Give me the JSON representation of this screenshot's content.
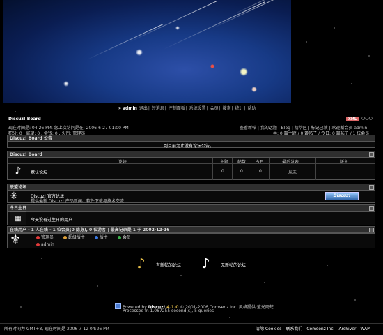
{
  "nav": {
    "user": "» admin",
    "links": [
      "退出",
      "短消息",
      "控制面板",
      "系统设置",
      "会员",
      "搜索",
      "统计",
      "帮助"
    ]
  },
  "board": {
    "name": "Discuz! Board",
    "xml_label": "XML",
    "time_line": "现在时间是: 04:26 PM, 您上次访问是在: 2006-6-27 01:00 PM",
    "points_line": "积分: 0 , 威望: 0 , 金钱: 0 , 头衔: 管理员",
    "right_links": "查看新帖 | 我的话题 | Blog | 精华区 | 标记已读 | 欢迎新会员 admin",
    "stats": "共: 0 篇主题 / 0 篇帖子 / 今日: 0 篇帖子 / 1 位会员"
  },
  "announcement": {
    "header": "Discuz! Board 公告",
    "text": "到目前为止没有论坛公告。"
  },
  "forum_table": {
    "header": "Discuz! Board",
    "columns": [
      "论坛",
      "主题",
      "帖数",
      "今日",
      "最后发表",
      "版主"
    ],
    "rows": [
      {
        "name": "默认论坛",
        "topics": "0",
        "posts": "0",
        "today": "0",
        "last": "从未",
        "mods": ""
      }
    ]
  },
  "links_section": {
    "header": "联盟论坛",
    "title": "Discuz! 官方论坛",
    "desc": "提供最新 Discuz! 产品新闻、软件下载与技术交流",
    "badge": "Discuz!"
  },
  "birthday": {
    "header": "今日生日",
    "text": "今天没有过生日的用户"
  },
  "online": {
    "header": "在线用户 - 1 人在线 - 1 位会员(0 隐身), 0 位游客 | 最高记录是 1 于 2002-12-16",
    "legend": [
      {
        "label": "管理员",
        "color": "#e23b3b"
      },
      {
        "label": "超级版主",
        "color": "#e0a23a"
      },
      {
        "label": "版主",
        "color": "#3a78e0"
      },
      {
        "label": "会员",
        "color": "#3ab24a"
      }
    ],
    "user": "admin"
  },
  "legend_icons": {
    "new_posts": "有新帖的论坛",
    "no_new_posts": "无新帖的论坛"
  },
  "powered": {
    "line1_prefix": "Powered by ",
    "product": "Discuz!",
    "version": "4.1.0",
    "line1_suffix": " © 2001-2006 Comsenz Inc. 风格提供:莹光雨蛇",
    "line2": "Processed in 1.067255 second(s), 5 queries"
  },
  "footer": {
    "left": "所有时间为 GMT+8, 现在时间是 2006-7-12 04:26 PM",
    "right": "清除 Cookies - 联系我们 - Comsenz Inc. - Archiver - WAP"
  }
}
